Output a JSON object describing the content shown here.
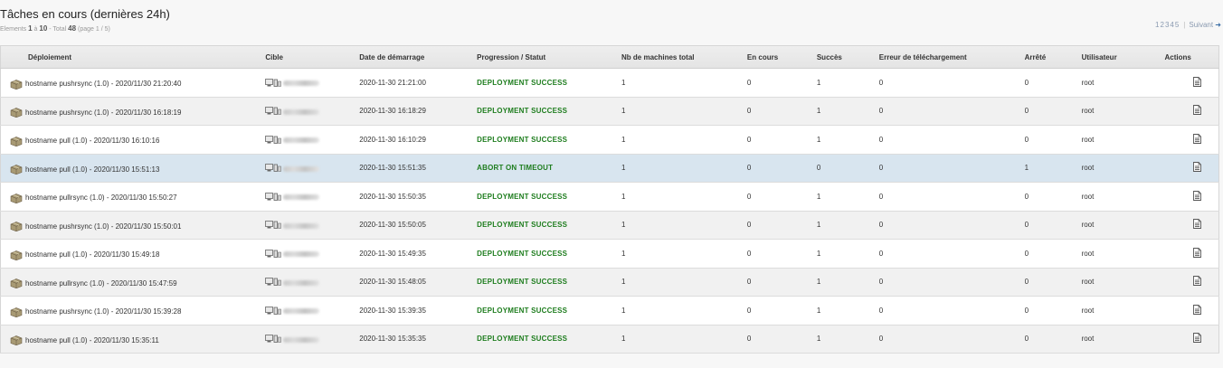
{
  "header": {
    "title": "Tâches en cours (dernières 24h)",
    "subtitle_prefix": "Elements",
    "range_from": "1",
    "range_sep": "à",
    "range_to": "10",
    "total_label": "- Total",
    "total": "48",
    "page_info": "(page 1 / 5)"
  },
  "pagination": {
    "pages": [
      "1",
      "2",
      "3",
      "4",
      "5"
    ],
    "next_label": "Suivant",
    "next_arrow": "➜"
  },
  "columns": {
    "deploiement": "Déploiement",
    "cible": "Cible",
    "date": "Date de démarrage",
    "progression": "Progression / Statut",
    "nb_machines": "Nb de machines total",
    "en_cours": "En cours",
    "succes": "Succès",
    "erreur": "Erreur de téléchargement",
    "arrete": "Arrêté",
    "utilisateur": "Utilisateur",
    "actions": "Actions"
  },
  "colors": {
    "status_text": "#1e7d1e",
    "highlight_row": "#d8e5ef",
    "header_bg": "#e8e8e8"
  },
  "icons": {
    "package": "package-icon",
    "target": "computer-icon",
    "action": "document-icon"
  },
  "rows": [
    {
      "name": "hostname pushrsync (1.0) - 2020/11/30 21:20:40",
      "date": "2020-11-30 21:21:00",
      "status": "DEPLOYMENT SUCCESS",
      "total": "1",
      "en_cours": "0",
      "succes": "1",
      "erreur": "0",
      "arrete": "0",
      "user": "root"
    },
    {
      "name": "hostname pushrsync (1.0) - 2020/11/30 16:18:19",
      "date": "2020-11-30 16:18:29",
      "status": "DEPLOYMENT SUCCESS",
      "total": "1",
      "en_cours": "0",
      "succes": "1",
      "erreur": "0",
      "arrete": "0",
      "user": "root"
    },
    {
      "name": "hostname pull (1.0) - 2020/11/30 16:10:16",
      "date": "2020-11-30 16:10:29",
      "status": "DEPLOYMENT SUCCESS",
      "total": "1",
      "en_cours": "0",
      "succes": "1",
      "erreur": "0",
      "arrete": "0",
      "user": "root"
    },
    {
      "name": "hostname pull (1.0) - 2020/11/30 15:51:13",
      "date": "2020-11-30 15:51:35",
      "status": "ABORT ON TIMEOUT",
      "total": "1",
      "en_cours": "0",
      "succes": "0",
      "erreur": "0",
      "arrete": "1",
      "user": "root"
    },
    {
      "name": "hostname pullrsync (1.0) - 2020/11/30 15:50:27",
      "date": "2020-11-30 15:50:35",
      "status": "DEPLOYMENT SUCCESS",
      "total": "1",
      "en_cours": "0",
      "succes": "1",
      "erreur": "0",
      "arrete": "0",
      "user": "root"
    },
    {
      "name": "hostname pushrsync (1.0) - 2020/11/30 15:50:01",
      "date": "2020-11-30 15:50:05",
      "status": "DEPLOYMENT SUCCESS",
      "total": "1",
      "en_cours": "0",
      "succes": "1",
      "erreur": "0",
      "arrete": "0",
      "user": "root"
    },
    {
      "name": "hostname pull (1.0) - 2020/11/30 15:49:18",
      "date": "2020-11-30 15:49:35",
      "status": "DEPLOYMENT SUCCESS",
      "total": "1",
      "en_cours": "0",
      "succes": "1",
      "erreur": "0",
      "arrete": "0",
      "user": "root"
    },
    {
      "name": "hostname pullrsync (1.0) - 2020/11/30 15:47:59",
      "date": "2020-11-30 15:48:05",
      "status": "DEPLOYMENT SUCCESS",
      "total": "1",
      "en_cours": "0",
      "succes": "1",
      "erreur": "0",
      "arrete": "0",
      "user": "root"
    },
    {
      "name": "hostname pushrsync (1.0) - 2020/11/30 15:39:28",
      "date": "2020-11-30 15:39:35",
      "status": "DEPLOYMENT SUCCESS",
      "total": "1",
      "en_cours": "0",
      "succes": "1",
      "erreur": "0",
      "arrete": "0",
      "user": "root"
    },
    {
      "name": "hostname pull (1.0) - 2020/11/30 15:35:11",
      "date": "2020-11-30 15:35:35",
      "status": "DEPLOYMENT SUCCESS",
      "total": "1",
      "en_cours": "0",
      "succes": "1",
      "erreur": "0",
      "arrete": "0",
      "user": "root"
    }
  ]
}
